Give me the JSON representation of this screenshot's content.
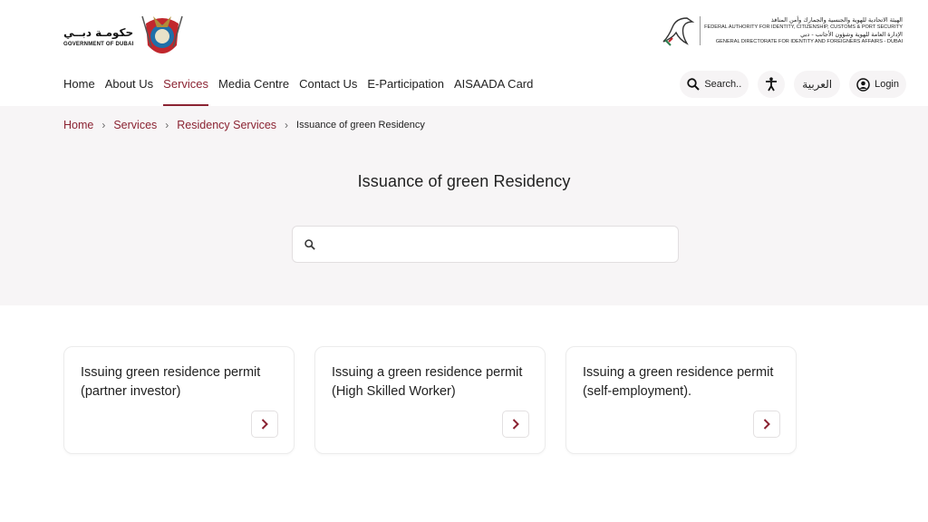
{
  "header": {
    "gov_logo_ar": "حكومـة دبــي",
    "gov_logo_en": "GOVERNMENT OF DUBAI",
    "authority_lines": [
      "الهيئة الاتحادية للهوية والجنسية والجمارك وأمن المنافذ",
      "FEDERAL AUTHORITY FOR IDENTITY, CITIZENSHIP, CUSTOMS & PORT SECURITY",
      "الإدارة العامة للهوية وشؤون الأجانب - دبي",
      "GENERAL DIRECTORATE FOR IDENTITY AND FOREIGNERS AFFAIRS - DUBAI"
    ]
  },
  "nav": {
    "items": [
      "Home",
      "About Us",
      "Services",
      "Media Centre",
      "Contact Us",
      "E-Participation",
      "AISAADA Card"
    ],
    "active_index": 2
  },
  "tools": {
    "search_label": "Search..",
    "accessibility_icon": "accessibility-icon",
    "arabic_label": "العربية",
    "login_label": "Login"
  },
  "breadcrumb": {
    "items": [
      "Home",
      "Services",
      "Residency Services"
    ],
    "current": "Issuance of green Residency"
  },
  "page": {
    "title": "Issuance of green Residency",
    "search_value": "",
    "search_placeholder": ""
  },
  "cards": [
    {
      "line1": "Issuing green residence permit",
      "line2": "(partner investor)"
    },
    {
      "line1": "Issuing a green residence permit",
      "line2": "(High Skilled Worker)"
    },
    {
      "line1": "Issuing a green residence permit",
      "line2": "(self-employment)."
    }
  ],
  "colors": {
    "accent": "#8b2332",
    "hero_bg": "#f7f5f6"
  }
}
